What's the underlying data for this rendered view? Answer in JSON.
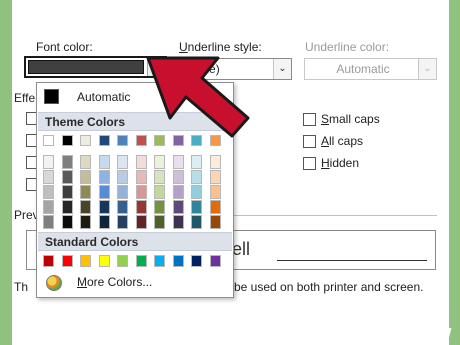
{
  "font_color": {
    "label": "Font color:",
    "selected_color": "#404040"
  },
  "underline_style": {
    "label": "Underline style:",
    "value": "(none)"
  },
  "underline_color": {
    "label": "Underline color:",
    "value": "Automatic"
  },
  "effects": {
    "label": "Effe",
    "small_caps": "Small caps",
    "all_caps": "All caps",
    "hidden": "Hidden"
  },
  "preview": {
    "label": "Prev",
    "sample_fragment": "ell",
    "note_left": "Th",
    "note_right": "be used on both printer and screen."
  },
  "color_popup": {
    "automatic_label": "Automatic",
    "theme_colors_label": "Theme Colors",
    "standard_colors_label": "Standard Colors",
    "more_colors_label": "More Colors...",
    "theme_top_row": [
      "#ffffff",
      "#000000",
      "#eeece1",
      "#1f497d",
      "#4f81bd",
      "#c0504d",
      "#9bbb59",
      "#8064a2",
      "#4bacc6",
      "#f79646"
    ],
    "theme_shades": [
      [
        "#f2f2f2",
        "#d8d8d8",
        "#bfbfbf",
        "#a5a5a5",
        "#7f7f7f"
      ],
      [
        "#7f7f7f",
        "#595959",
        "#3f3f3f",
        "#262626",
        "#0c0c0c"
      ],
      [
        "#ddd9c3",
        "#c4bd97",
        "#938953",
        "#494429",
        "#1d1b10"
      ],
      [
        "#c6d9f0",
        "#8db3e2",
        "#548dd4",
        "#17365d",
        "#0f243e"
      ],
      [
        "#dbe5f1",
        "#b8cce4",
        "#95b3d7",
        "#366092",
        "#244061"
      ],
      [
        "#f2dcdb",
        "#e5b9b7",
        "#d99694",
        "#953734",
        "#632423"
      ],
      [
        "#ebf1dd",
        "#d7e3bc",
        "#c3d69b",
        "#76923c",
        "#4f6128"
      ],
      [
        "#e5e0ec",
        "#ccc1d9",
        "#b2a2c7",
        "#5f497a",
        "#3f3151"
      ],
      [
        "#dbeef3",
        "#b7dde8",
        "#92cddc",
        "#31859b",
        "#205867"
      ],
      [
        "#fdeada",
        "#fbd5b5",
        "#fac08f",
        "#e36c09",
        "#974806"
      ]
    ],
    "standard_row": [
      "#c00000",
      "#ff0000",
      "#ffc000",
      "#ffff00",
      "#92d050",
      "#00b050",
      "#00b0f0",
      "#0070c0",
      "#002060",
      "#7030a0"
    ]
  },
  "arrow_color": "#c8102e",
  "icons": [
    "dropdown-arrow-icon",
    "more-colors-palette-icon",
    "red-pointer-arrow-icon"
  ],
  "watermark": {
    "prefix": "wiki",
    "suffix": "How"
  }
}
